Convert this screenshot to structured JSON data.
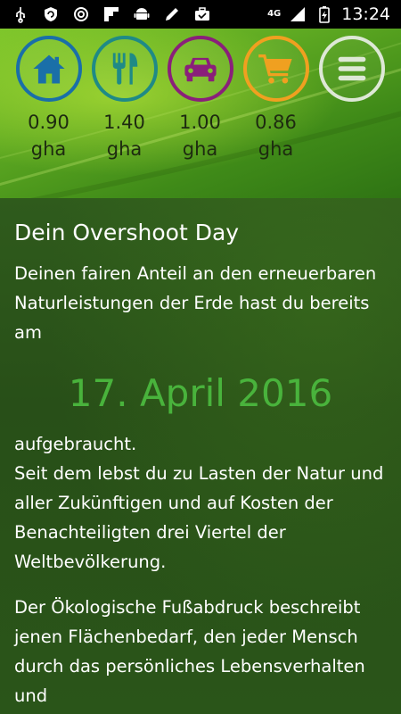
{
  "status_bar": {
    "network": "4G",
    "time": "13:24",
    "icons": [
      "usb-icon",
      "shield-refresh-icon",
      "sync-icon",
      "flipboard-icon",
      "android-icon",
      "pen-icon",
      "briefcase-icon",
      "signal-icon",
      "battery-charging-icon"
    ]
  },
  "nav": {
    "items": [
      {
        "icon": "house-icon",
        "color": "#1a6fa8",
        "value": "0.90",
        "unit": "gha"
      },
      {
        "icon": "fork-knife-icon",
        "color": "#1f8a86",
        "value": "1.40",
        "unit": "gha"
      },
      {
        "icon": "car-icon",
        "color": "#8a1f7a",
        "value": "1.00",
        "unit": "gha"
      },
      {
        "icon": "cart-icon",
        "color": "#f0a020",
        "value": "0.86",
        "unit": "gha"
      }
    ],
    "menu": {
      "icon": "hamburger-menu-icon",
      "color": "#dde8d6"
    }
  },
  "content": {
    "title": "Dein Overshoot Day",
    "intro": "Deinen fairen Anteil an den erneuerbaren Naturleistungen der Erde hast du bereits am",
    "date": "17. April 2016",
    "after_date_line1": "aufgebraucht.",
    "after_date_line2": "Seit dem lebst du zu Lasten der Natur und aller Zukünftigen und auf Kosten der Benachteiligten drei Viertel der Weltbevölkerung.",
    "footprint": "Der Ökologische Fußabdruck beschreibt jenen Flächenbedarf, den jeder Mensch durch das persönliches Lebensverhalten und"
  }
}
